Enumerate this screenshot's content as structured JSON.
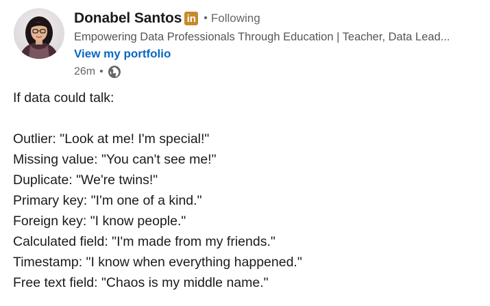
{
  "author": {
    "name": "Donabel Santos",
    "badge": "in",
    "separator": "•",
    "follow_status": "Following",
    "headline": "Empowering Data Professionals Through Education | Teacher, Data Lead...",
    "portfolio_link": "View my portfolio"
  },
  "meta": {
    "time": "26m",
    "separator": "•",
    "visibility_icon": "globe-icon"
  },
  "post": {
    "intro": "If data could talk:",
    "lines": [
      "Outlier: \"Look at me! I'm special!\"",
      "Missing value: \"You can't see me!\"",
      "Duplicate: \"We're twins!\"",
      "Primary key: \"I'm one of a kind.\"",
      "Foreign key: \"I know people.\"",
      "Calculated field: \"I'm made from my friends.\"",
      "Timestamp: \"I know when everything happened.\"",
      "Free text field: \"Chaos is my middle name.\""
    ]
  },
  "colors": {
    "link": "#0a66c2",
    "badge": "#c58a2a",
    "secondary_text": "#666666"
  }
}
